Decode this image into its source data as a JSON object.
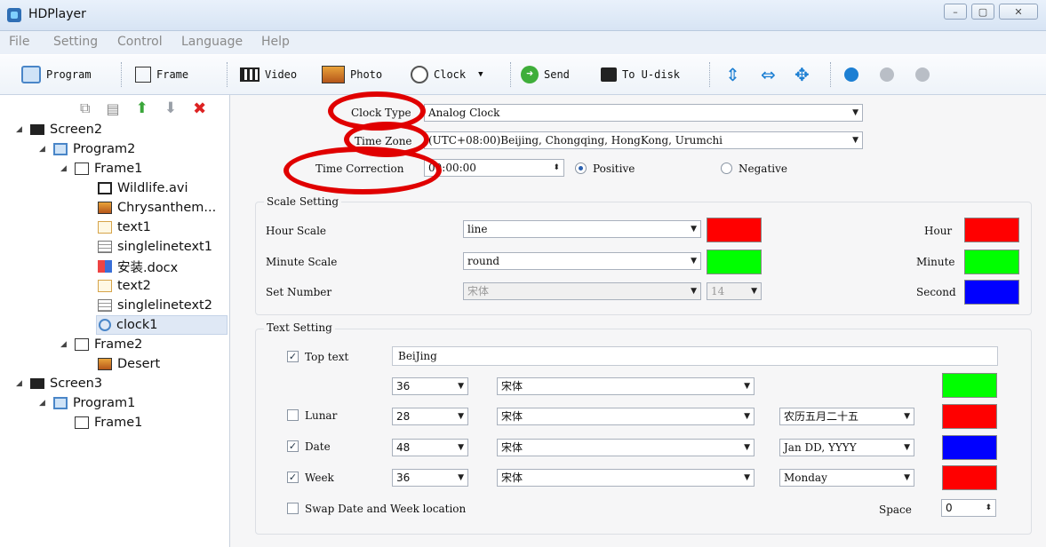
{
  "window": {
    "title": "HDPlayer",
    "controls": [
      "–",
      "▢",
      "✕"
    ]
  },
  "menu": [
    "File",
    "Setting",
    "Control",
    "Language",
    "Help"
  ],
  "toolbar": {
    "program": "Program",
    "frame": "Frame",
    "video": "Video",
    "photo": "Photo",
    "clock": "Clock",
    "send": "Send",
    "to_udisk": "To U-disk"
  },
  "tree": [
    {
      "label": "Screen2",
      "icon": "monitor-icon"
    },
    {
      "label": "Program2",
      "icon": "program-icon"
    },
    {
      "label": "Frame1",
      "icon": "frame-icon"
    },
    {
      "label": "Wildlife.avi",
      "icon": "video-icon"
    },
    {
      "label": "Chrysanthem...",
      "icon": "photo-icon"
    },
    {
      "label": "text1",
      "icon": "text-icon"
    },
    {
      "label": "singlelinetext1",
      "icon": "singleline-text-icon"
    },
    {
      "label": "安装.docx",
      "icon": "document-icon"
    },
    {
      "label": "text2",
      "icon": "text-icon"
    },
    {
      "label": "singlelinetext2",
      "icon": "singleline-text-icon"
    },
    {
      "label": "clock1",
      "icon": "clock-icon"
    },
    {
      "label": "Frame2",
      "icon": "frame-icon"
    },
    {
      "label": "Desert",
      "icon": "photo-icon"
    },
    {
      "label": "Screen3",
      "icon": "monitor-icon"
    },
    {
      "label": "Program1",
      "icon": "program-icon"
    },
    {
      "label": "Frame1",
      "icon": "frame-icon"
    }
  ],
  "clock": {
    "type_label": "Clock Type",
    "type_value": "Analog Clock",
    "zone_label": "Time Zone",
    "zone_value": "(UTC+08:00)Beijing, Chongqing, HongKong, Urumchi",
    "correction_label": "Time Correction",
    "correction_value": "00:00:00",
    "positive": "Positive",
    "negative": "Negative"
  },
  "scale": {
    "title": "Scale Setting",
    "hour_label": "Hour Scale",
    "hour_value": "line",
    "minute_label": "Minute Scale",
    "minute_value": "round",
    "number_label": "Set Number",
    "number_font": "宋体",
    "number_size": "14",
    "hand_hour": "Hour",
    "hand_minute": "Minute",
    "hand_second": "Second",
    "colors": {
      "hour_scale": "#ff0000",
      "minute_scale": "#00ff00",
      "hour": "#ff0000",
      "minute": "#00ff00",
      "second": "#0000ff"
    }
  },
  "text": {
    "title": "Text Setting",
    "top_label": "Top text",
    "top_value": "BeiJing",
    "top_size": "36",
    "top_font": "宋体",
    "lunar_label": "Lunar",
    "lunar_size": "28",
    "lunar_font": "宋体",
    "lunar_format": "农历五月二十五",
    "date_label": "Date",
    "date_size": "48",
    "date_font": "宋体",
    "date_format": "Jan DD, YYYY",
    "week_label": "Week",
    "week_size": "36",
    "week_font": "宋体",
    "week_format": "Monday",
    "swap_label": "Swap Date and Week location",
    "space_label": "Space",
    "space_value": "0",
    "colors": {
      "top": "#00ff00",
      "lunar": "#ff0000",
      "date": "#0000ff",
      "week": "#ff0000"
    }
  }
}
